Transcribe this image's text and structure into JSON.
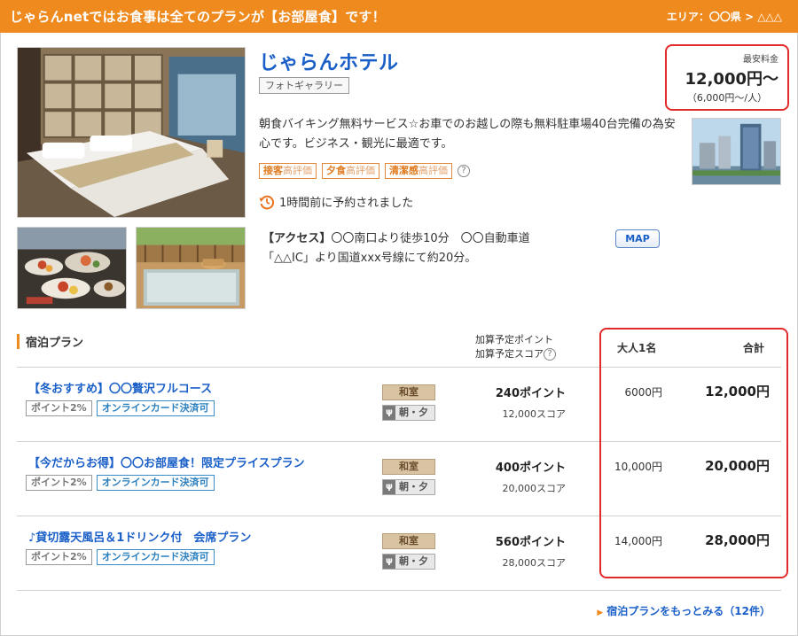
{
  "banner": {
    "title": "じゃらんnetではお食事は全てのプランが【お部屋食】です！",
    "area": "エリア：〇〇県 > △△△"
  },
  "hotel": {
    "name": "じゃらんホテル",
    "gallery_label": "フォトギャラリー",
    "description": "朝食バイキング無料サービス☆お車でのお越しの際も無料駐車場40台完備の為安心です。ビジネス・観光に最適です。",
    "tags": [
      {
        "highlight": "接客",
        "rating": "高評価"
      },
      {
        "highlight": "夕食",
        "rating": "高評価"
      },
      {
        "highlight": "清潔感",
        "rating": "高評価"
      }
    ],
    "help_mark": "?",
    "booked_text": "1時間前に予約されました",
    "access_label": "【アクセス】",
    "access_line1": "〇〇南口より徒歩10分　〇〇自動車道",
    "access_line2": "「△△IC」より国道xxx号線にて約20分。",
    "map_label": "MAP"
  },
  "price": {
    "label": "最安料金",
    "value": "12,000円〜",
    "per_person": "（6,000円〜/人）"
  },
  "plans": {
    "section_title": "宿泊プラン",
    "col_points_line1": "加算予定ポイント",
    "col_points_line2": "加算予定スコア",
    "col_adult": "大人1名",
    "col_total": "合計",
    "items": [
      {
        "name": "【冬おすすめ】〇〇贅沢フルコース",
        "badge_point": "ポイント2%",
        "badge_card": "オンラインカード決済可",
        "room": "和室",
        "meal": "朝・夕",
        "points": "240ポイント",
        "score": "12,000スコア",
        "adult": "6000円",
        "total": "12,000円"
      },
      {
        "name": "【今だからお得】〇〇お部屋食！限定プライスプラン",
        "badge_point": "ポイント2%",
        "badge_card": "オンラインカード決済可",
        "room": "和室",
        "meal": "朝・夕",
        "points": "400ポイント",
        "score": "20,000スコア",
        "adult": "10,000円",
        "total": "20,000円"
      },
      {
        "name": "♪貸切露天風呂＆1ドリンク付　会席プラン",
        "badge_point": "ポイント2%",
        "badge_card": "オンラインカード決済可",
        "room": "和室",
        "meal": "朝・夕",
        "points": "560ポイント",
        "score": "28,000スコア",
        "adult": "14,000円",
        "total": "28,000円"
      }
    ],
    "more_link": "宿泊プランをもっとみる（12件）"
  },
  "colors": {
    "accent": "#ee8a1e",
    "link": "#1a5fc8",
    "highlight_border": "#e32a2a"
  }
}
